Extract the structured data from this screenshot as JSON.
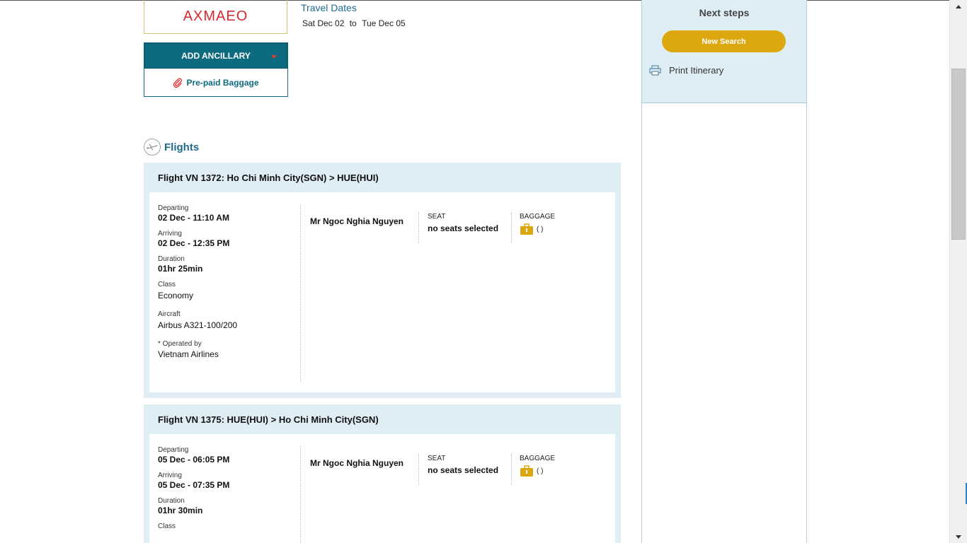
{
  "booking": {
    "reference": "AXMAEO",
    "travel_dates_label": "Travel Dates",
    "date_from": "Sat Dec 02",
    "date_sep": "to",
    "date_to": "Tue Dec 05"
  },
  "ancillary": {
    "button_label": "ADD ANCILLARY",
    "item_label": "Pre-paid Baggage"
  },
  "flights_section": {
    "title": "Flights"
  },
  "labels": {
    "departing": "Departing",
    "arriving": "Arriving",
    "duration": "Duration",
    "class": "Class",
    "aircraft": "Aircraft",
    "operated_by": "* Operated by",
    "seat": "SEAT",
    "baggage": "BAGGAGE"
  },
  "flights": [
    {
      "title": "Flight VN 1372: Ho Chi Minh City(SGN) > HUE(HUI)",
      "departing": "02 Dec - 11:10 AM",
      "arriving": "02 Dec - 12:35 PM",
      "duration": "01hr 25min",
      "class": "Economy",
      "aircraft": "Airbus A321-100/200",
      "operated_by": "Vietnam Airlines",
      "passenger": "Mr Ngoc Nghia Nguyen",
      "seat": "no seats selected",
      "baggage": "( )"
    },
    {
      "title": "Flight VN 1375: HUE(HUI) > Ho Chi Minh City(SGN)",
      "departing": "05 Dec - 06:05 PM",
      "arriving": "05 Dec - 07:35 PM",
      "duration": "01hr 30min",
      "class_label_partial": "Class",
      "passenger": "Mr Ngoc Nghia Nguyen",
      "seat": "no seats selected",
      "baggage": "( )"
    }
  ],
  "sidebar": {
    "title": "Next steps",
    "new_search": "New Search",
    "print_itinerary": "Print Itinerary"
  },
  "colors": {
    "brand_teal": "#0d6b80",
    "accent_gold": "#dda70f",
    "ref_red": "#d9272e",
    "panel_blue": "#dfeef5"
  }
}
